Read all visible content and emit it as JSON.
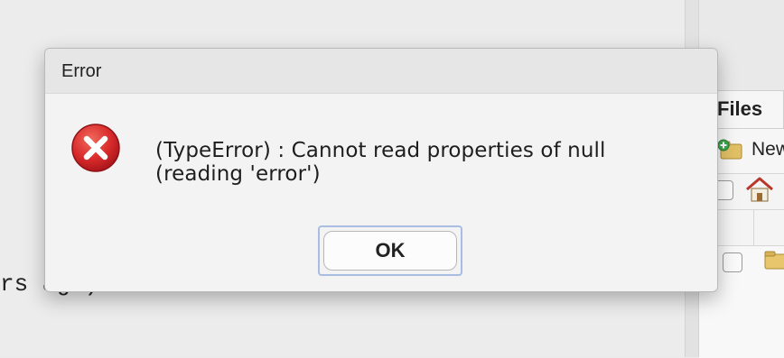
{
  "dialog": {
    "title": "Error",
    "message_line1": "(TypeError) : Cannot read properties of null",
    "message_line2": "(reading 'error')",
    "ok_label": "OK",
    "icon": "error-icon"
  },
  "files_pane": {
    "tab_label": "Files",
    "new_label": "New"
  },
  "console": {
    "partial_text": "rs ago)"
  },
  "colors": {
    "error_red": "#d92b2b",
    "focus_ring": "#a9bde2"
  }
}
